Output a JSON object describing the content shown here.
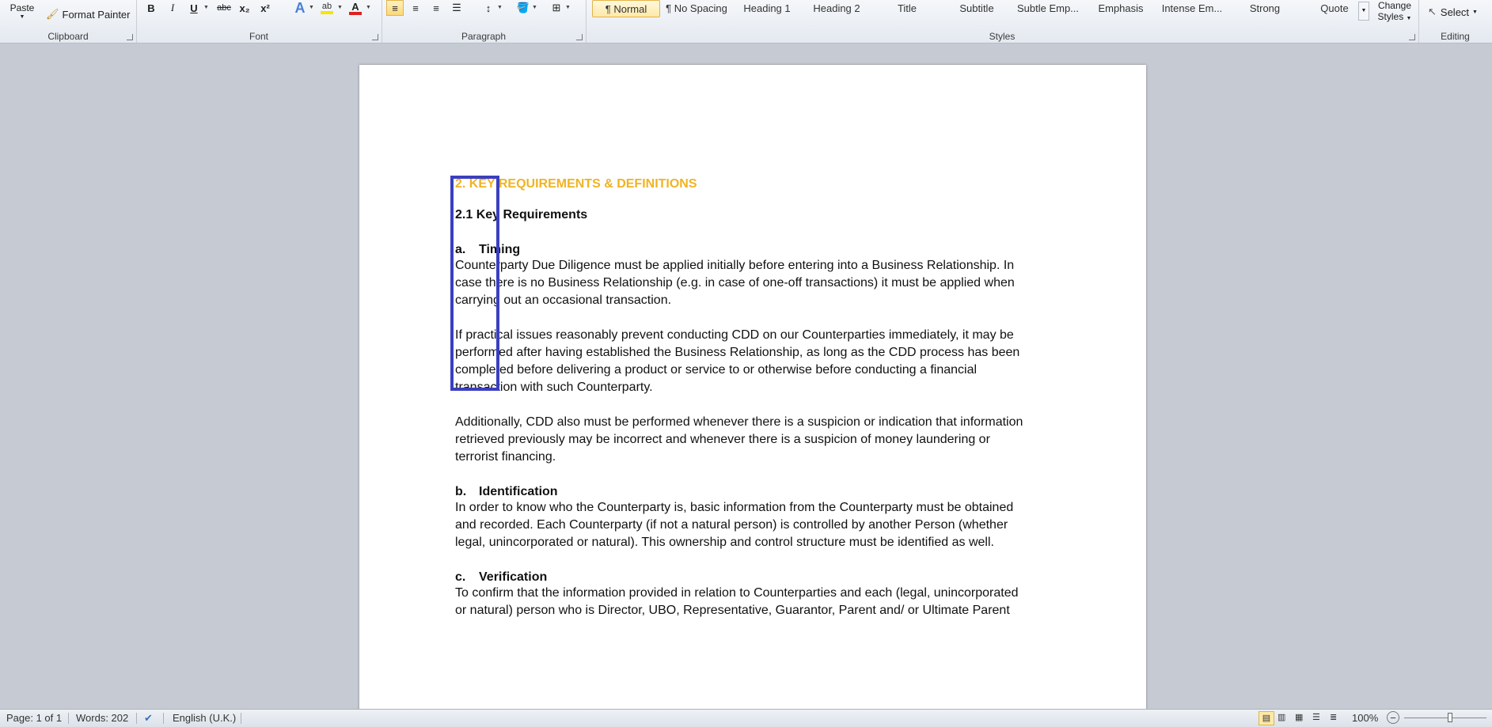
{
  "ribbon": {
    "clipboard": {
      "paste_label": "Paste",
      "format_painter_label": "Format Painter",
      "group_label": "Clipboard"
    },
    "font": {
      "group_label": "Font",
      "bold": "B",
      "italic": "I",
      "underline": "U",
      "strike": "abc",
      "subscript": "x₂",
      "superscript": "x²",
      "font_color_accent": "#e02020",
      "highlight_accent": "#f5e600"
    },
    "paragraph": {
      "group_label": "Paragraph"
    },
    "styles": {
      "group_label": "Styles",
      "items": [
        "¶ Normal",
        "¶ No Spacing",
        "Heading 1",
        "Heading 2",
        "Title",
        "Subtitle",
        "Subtle Emp...",
        "Emphasis",
        "Intense Em...",
        "Strong",
        "Quote"
      ],
      "change_styles_line1": "Change",
      "change_styles_line2": "Styles"
    },
    "editing": {
      "group_label": "Editing",
      "select_label": "Select"
    }
  },
  "document": {
    "heading1": "2. KEY REQUIREMENTS & DEFINITIONS",
    "heading1_color": "#f0b323",
    "heading2": "2.1 Key Requirements",
    "sections": [
      {
        "num": "a.",
        "title": "Timing",
        "paragraphs": [
          "Counterparty Due Diligence must be applied initially before entering into a Business Relationship. In\ncase there is no Business Relationship (e.g. in case of one-off transactions) it must be applied when\ncarrying out an occasional transaction.",
          "If practical issues reasonably prevent conducting CDD on our Counterparties immediately, it may be\nperformed after having established the Business Relationship, as long as the CDD process has been\ncompleted before delivering a product or service to or otherwise before conducting a financial\ntransaction with such Counterparty.",
          "Additionally, CDD also must be performed whenever there is a suspicion or indication that information\nretrieved previously may be incorrect and whenever there is a suspicion of money laundering or\nterrorist financing."
        ]
      },
      {
        "num": "b.",
        "title": "Identification",
        "paragraphs": [
          "In order to know who the Counterparty is, basic information from the Counterparty must be obtained\nand recorded. Each Counterparty (if not a natural person) is controlled by another Person (whether\nlegal, unincorporated or natural). This ownership and control structure must be identified as well."
        ]
      },
      {
        "num": "c.",
        "title": "Verification",
        "paragraphs": [
          "To confirm that the information provided in relation to Counterparties and each (legal, unincorporated\nor natural) person who is Director, UBO, Representative, Guarantor, Parent and/ or Ultimate Parent"
        ]
      }
    ]
  },
  "status_bar": {
    "page": "Page: 1 of 1",
    "words": "Words: 202",
    "language": "English (U.K.)",
    "zoom": "100%"
  }
}
